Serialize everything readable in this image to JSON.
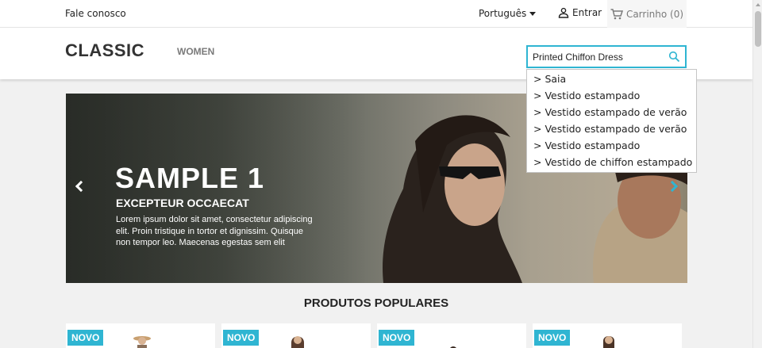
{
  "topbar": {
    "contact": "Fale conosco",
    "language": "Português",
    "signin": "Entrar",
    "cart": "Carrinho (0)"
  },
  "header": {
    "logo": "CLASSIC",
    "nav": [
      "WOMEN"
    ]
  },
  "search": {
    "value": "Printed Chiffon Dress",
    "suggestions": [
      "> Saia",
      "> Vestido estampado",
      "> Vestido estampado de verão",
      "> Vestido estampado de verão",
      "> Vestido estampado",
      "> Vestido de chiffon estampado"
    ]
  },
  "slider": {
    "title": "SAMPLE 1",
    "subtitle": "EXCEPTEUR OCCAECAT",
    "description": "Lorem ipsum dolor sit amet, consectetur adipiscing elit. Proin tristique in tortor et dignissim. Quisque non tempor leo. Maecenas egestas sem elit"
  },
  "products": {
    "title": "PRODUTOS POPULARES",
    "items": [
      {
        "badge": "NOVO"
      },
      {
        "badge": "NOVO"
      },
      {
        "badge": "NOVO"
      },
      {
        "badge": "NOVO"
      }
    ]
  },
  "colors": {
    "accent": "#2fb5d2",
    "text": "#232323"
  }
}
